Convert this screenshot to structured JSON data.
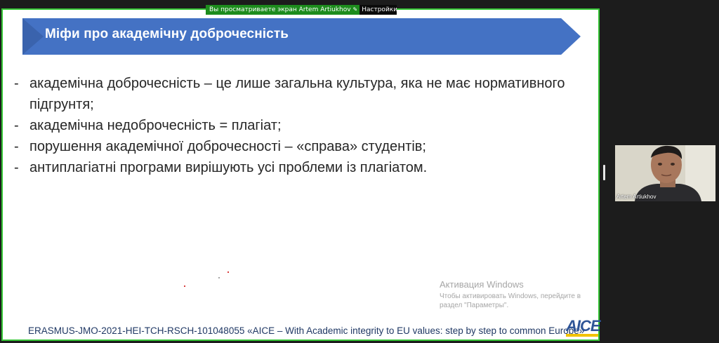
{
  "share_bar": {
    "text": "Вы просматриваете экран Artem Artiukhov",
    "settings_label": "Настройки просмотра"
  },
  "slide": {
    "title": "Міфи про академічну доброчесність",
    "bullets": [
      "академічна доброчесність – це лише загальна культура, яка не має нормативного підгрунтя;",
      "академічна недоброчесність = плагіат;",
      "порушення академічної доброчесності – «справа» студентів;",
      "антиплагіатні програми вирішують усі проблеми із плагіатом."
    ],
    "bullet_marker": "-",
    "footer": "ERASMUS-JMO-2021-HEI-TCH-RSCH-101048055 «AICE – With Academic integrity to EU values: step by step to common Europe»",
    "logo_text": "AICE"
  },
  "activation": {
    "title": "Активация Windows",
    "message": "Чтобы активировать Windows, перейдите в раздел \"Параметры\"."
  },
  "participant": {
    "name": "Artem Artiukhov"
  },
  "colors": {
    "banner": "#4472c4",
    "share_border": "#35c435",
    "share_bar": "#1d8c1d",
    "logo_blue": "#2f5597",
    "logo_yellow": "#f2c200"
  }
}
